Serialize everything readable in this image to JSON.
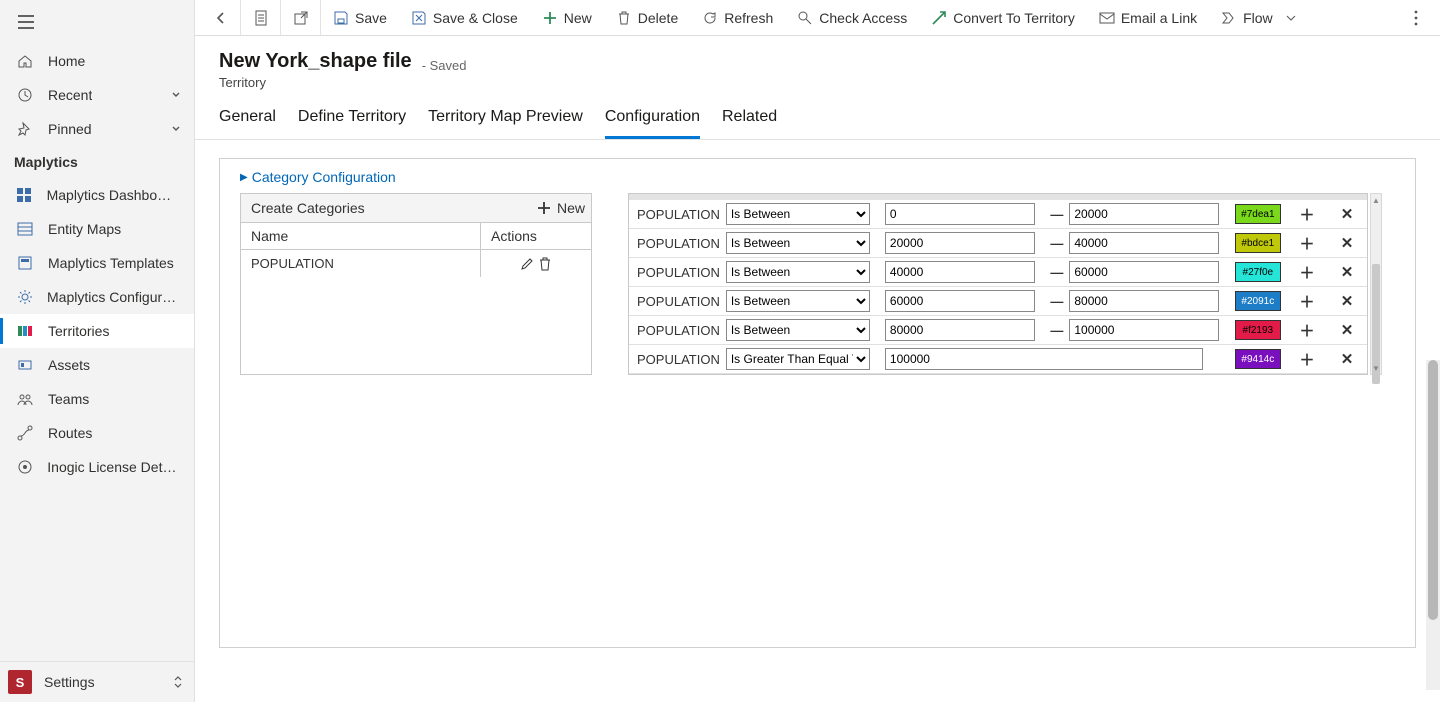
{
  "sidebar": {
    "top": [
      {
        "label": "Home",
        "icon": "home-icon",
        "chev": false
      },
      {
        "label": "Recent",
        "icon": "clock-icon",
        "chev": true
      },
      {
        "label": "Pinned",
        "icon": "pin-icon",
        "chev": true
      }
    ],
    "section_title": "Maplytics",
    "items": [
      {
        "label": "Maplytics Dashboard...",
        "icon": "dashboard-icon",
        "active": false
      },
      {
        "label": "Entity Maps",
        "icon": "list-icon",
        "active": false
      },
      {
        "label": "Maplytics Templates",
        "icon": "template-icon",
        "active": false
      },
      {
        "label": "Maplytics Configurat...",
        "icon": "config-icon",
        "active": false
      },
      {
        "label": "Territories",
        "icon": "territory-icon",
        "active": true
      },
      {
        "label": "Assets",
        "icon": "asset-icon",
        "active": false
      },
      {
        "label": "Teams",
        "icon": "team-icon",
        "active": false
      },
      {
        "label": "Routes",
        "icon": "route-icon",
        "active": false
      },
      {
        "label": "Inogic License Details",
        "icon": "license-icon",
        "active": false
      }
    ],
    "settings_letter": "S",
    "settings_label": "Settings"
  },
  "toolbar": {
    "save": "Save",
    "save_close": "Save & Close",
    "new": "New",
    "delete": "Delete",
    "refresh": "Refresh",
    "check_access": "Check Access",
    "convert_territory": "Convert To Territory",
    "email_link": "Email a Link",
    "flow": "Flow"
  },
  "record": {
    "title": "New York_shape file",
    "status": "- Saved",
    "entity": "Territory"
  },
  "tabs": [
    "General",
    "Define Territory",
    "Territory Map Preview",
    "Configuration",
    "Related"
  ],
  "active_tab": "Configuration",
  "section": "Category Configuration",
  "categories": {
    "header": "Create Categories",
    "new_label": "New",
    "col_name": "Name",
    "col_actions": "Actions",
    "rows": [
      {
        "name": "POPULATION"
      }
    ]
  },
  "rules": {
    "field": "POPULATION",
    "op_between": "Is Between",
    "op_gte": "Is Greater Than Equal To",
    "dash": "—",
    "rows": [
      {
        "from": "0",
        "to": "20000",
        "color_label": "#7dea1",
        "color": "#7ad91a"
      },
      {
        "from": "20000",
        "to": "40000",
        "color_label": "#bdce1",
        "color": "#c0c80a"
      },
      {
        "from": "40000",
        "to": "60000",
        "color_label": "#27f0e",
        "color": "#25e4d8"
      },
      {
        "from": "60000",
        "to": "80000",
        "color_label": "#2091c",
        "color": "#1e7dc7"
      },
      {
        "from": "80000",
        "to": "100000",
        "color_label": "#f2193",
        "color": "#e31b49"
      },
      {
        "single": "100000",
        "op": "gte",
        "color_label": "#9414c",
        "color": "#7a0fbd"
      }
    ]
  }
}
